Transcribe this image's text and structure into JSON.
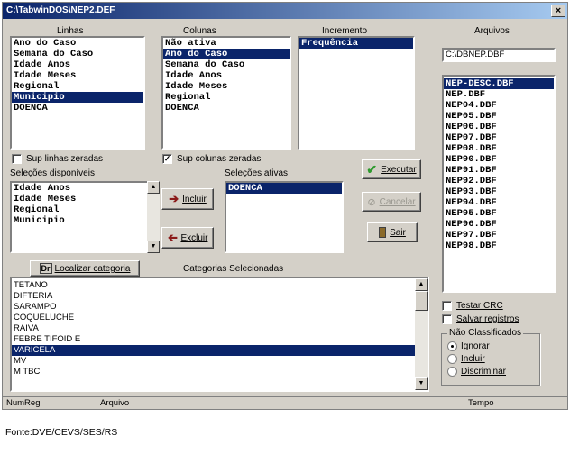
{
  "window": {
    "title": "C:\\TabwinDOS\\NEP2.DEF",
    "close": "×"
  },
  "labels": {
    "linhas": "Linhas",
    "colunas": "Colunas",
    "incremento": "Incremento",
    "arquivos": "Arquivos",
    "selecoes_disponiveis": "Seleções disponíveis",
    "selecoes_ativas": "Seleções ativas",
    "categorias_selecionadas": "Categorias Selecionadas"
  },
  "linhas": [
    {
      "text": "Ano do Caso",
      "selected": false
    },
    {
      "text": "Semana do Caso",
      "selected": false
    },
    {
      "text": "Idade Anos",
      "selected": false
    },
    {
      "text": "Idade Meses",
      "selected": false
    },
    {
      "text": "Regional",
      "selected": false
    },
    {
      "text": "Municipio",
      "selected": true
    },
    {
      "text": "DOENCA",
      "selected": false
    }
  ],
  "colunas": [
    {
      "text": "Não ativa",
      "selected": false
    },
    {
      "text": "Ano do Caso",
      "selected": true
    },
    {
      "text": "Semana do Caso",
      "selected": false
    },
    {
      "text": "Idade Anos",
      "selected": false
    },
    {
      "text": "Idade Meses",
      "selected": false
    },
    {
      "text": "Regional",
      "selected": false
    },
    {
      "text": "DOENCA",
      "selected": false
    }
  ],
  "incremento": [
    {
      "text": "Frequência",
      "selected": true
    }
  ],
  "arquivos": {
    "path": "C:\\DBNEP.DBF",
    "files": [
      {
        "text": "NEP-DESC.DBF",
        "selected": true
      },
      {
        "text": "NEP.DBF",
        "selected": false
      },
      {
        "text": "NEP04.DBF",
        "selected": false
      },
      {
        "text": "NEP05.DBF",
        "selected": false
      },
      {
        "text": "NEP06.DBF",
        "selected": false
      },
      {
        "text": "NEP07.DBF",
        "selected": false
      },
      {
        "text": "NEP08.DBF",
        "selected": false
      },
      {
        "text": "NEP90.DBF",
        "selected": false
      },
      {
        "text": "NEP91.DBF",
        "selected": false
      },
      {
        "text": "NEP92.DBF",
        "selected": false
      },
      {
        "text": "NEP93.DBF",
        "selected": false
      },
      {
        "text": "NEP94.DBF",
        "selected": false
      },
      {
        "text": "NEP95.DBF",
        "selected": false
      },
      {
        "text": "NEP96.DBF",
        "selected": false
      },
      {
        "text": "NEP97.DBF",
        "selected": false
      },
      {
        "text": "NEP98.DBF",
        "selected": false
      }
    ]
  },
  "checks": {
    "sup_linhas": {
      "label": "Sup linhas zeradas",
      "checked": false
    },
    "sup_colunas": {
      "label": "Sup colunas zeradas",
      "checked": true
    },
    "testar_crc": {
      "label": "Testar CRC",
      "checked": false
    },
    "salvar_registros": {
      "label": "Salvar registros",
      "checked": false
    }
  },
  "selecoes_disponiveis": [
    {
      "text": "Idade Anos",
      "selected": false
    },
    {
      "text": "Idade Meses",
      "selected": false
    },
    {
      "text": "Regional",
      "selected": false
    },
    {
      "text": "Municipio",
      "selected": false
    }
  ],
  "selecoes_ativas": [
    {
      "text": "DOENCA",
      "selected": true
    }
  ],
  "buttons": {
    "incluir": "Incluir",
    "excluir": "Excluir",
    "executar": "Executar",
    "cancelar": "Cancelar",
    "sair": "Sair",
    "localizar": "Localizar categoria",
    "localizar_icon_text": "Dr"
  },
  "categorias": [
    {
      "text": "TETANO",
      "selected": false
    },
    {
      "text": "DIFTERIA",
      "selected": false
    },
    {
      "text": "SARAMPO",
      "selected": false
    },
    {
      "text": "COQUELUCHE",
      "selected": false
    },
    {
      "text": "RAIVA",
      "selected": false
    },
    {
      "text": "FEBRE TIFOID E",
      "selected": false
    },
    {
      "text": "VARICELA",
      "selected": true
    },
    {
      "text": "MV",
      "selected": false
    },
    {
      "text": "M TBC",
      "selected": false
    }
  ],
  "nao_classificados": {
    "title": "Não Classificados",
    "options": [
      {
        "label": "Ignorar",
        "selected": true
      },
      {
        "label": "Incluir",
        "selected": false
      },
      {
        "label": "Discriminar",
        "selected": false
      }
    ]
  },
  "status": {
    "numreg": "NumReg",
    "arquivo": "Arquivo",
    "tempo": "Tempo"
  },
  "source": "Fonte:DVE/CEVS/SES/RS",
  "colors": {
    "selection": "#0a246a",
    "face": "#d4d0c8",
    "check_green": "#2e9a2e",
    "arrow_red": "#8b1a1a"
  }
}
